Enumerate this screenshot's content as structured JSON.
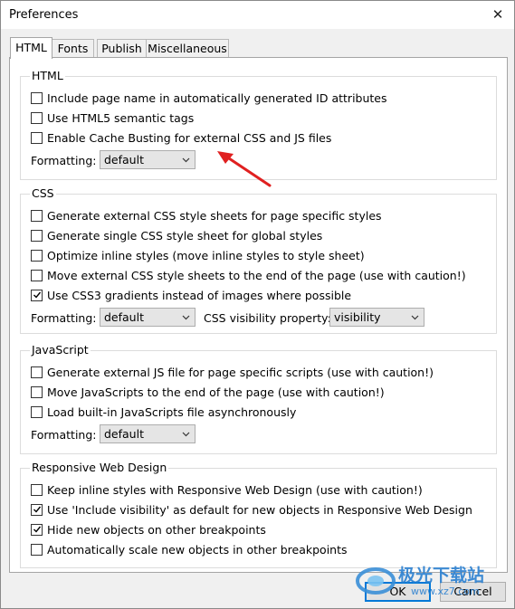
{
  "window": {
    "title": "Preferences",
    "close_glyph": "✕"
  },
  "tabs": [
    "HTML",
    "Fonts",
    "Publish",
    "Miscellaneous"
  ],
  "html_group": {
    "label": "HTML",
    "options": [
      {
        "label": "Include page name in automatically generated ID attributes",
        "checked": false
      },
      {
        "label": "Use HTML5 semantic tags",
        "checked": false
      },
      {
        "label": "Enable Cache Busting for external CSS and JS files",
        "checked": false
      }
    ],
    "formatting_label": "Formatting:",
    "formatting_value": "default"
  },
  "css_group": {
    "label": "CSS",
    "options": [
      {
        "label": "Generate external CSS style sheets for page specific styles",
        "checked": false
      },
      {
        "label": "Generate single CSS style sheet for global styles",
        "checked": false
      },
      {
        "label": "Optimize inline styles (move inline styles to style sheet)",
        "checked": false
      },
      {
        "label": "Move external CSS style sheets to the end of the page (use with caution!)",
        "checked": false
      },
      {
        "label": "Use CSS3 gradients instead of images where possible",
        "checked": true
      }
    ],
    "formatting_label": "Formatting:",
    "formatting_value": "default",
    "visibility_label": "CSS visibility property:",
    "visibility_value": "visibility"
  },
  "js_group": {
    "label": "JavaScript",
    "options": [
      {
        "label": "Generate external JS file for page specific scripts (use with caution!)",
        "checked": false
      },
      {
        "label": "Move JavaScripts to the end of the page (use with caution!)",
        "checked": false
      },
      {
        "label": "Load built-in JavaScripts file asynchronously",
        "checked": false
      }
    ],
    "formatting_label": "Formatting:",
    "formatting_value": "default"
  },
  "rwd_group": {
    "label": "Responsive Web Design",
    "options": [
      {
        "label": "Keep inline styles with Responsive Web Design (use with caution!)",
        "checked": false
      },
      {
        "label": "Use 'Include visibility' as default for new objects in Responsive Web Design",
        "checked": true
      },
      {
        "label": "Hide new objects on other breakpoints",
        "checked": true
      },
      {
        "label": "Automatically scale new objects in other breakpoints",
        "checked": false
      }
    ]
  },
  "buttons": {
    "ok": "OK",
    "cancel": "Cancel"
  },
  "watermark": {
    "line1": "极光下载站",
    "line2": "www.xz7.com"
  },
  "colors": {
    "accent": "#0078d7",
    "arrow": "#e02020"
  }
}
